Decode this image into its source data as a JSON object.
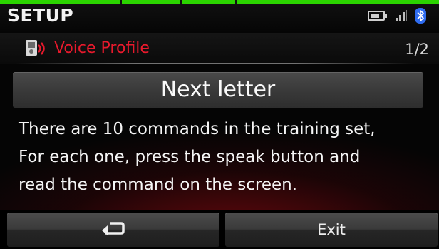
{
  "header": {
    "title": "SETUP",
    "icons": [
      "battery-icon",
      "signal-icon",
      "bluetooth-icon"
    ]
  },
  "subheader": {
    "icon": "voice-profile-icon",
    "label": "Voice Profile",
    "page": "1/2"
  },
  "prompt": {
    "text": "Next letter"
  },
  "message": {
    "lines": [
      "There are 10 commands in the training set,",
      "For each one, press the speak button and",
      "read the command on the screen."
    ]
  },
  "buttons": {
    "back_icon": "return-arrow-icon",
    "exit_label": "Exit"
  },
  "colors": {
    "accent_red": "#e8192c",
    "top_strip_green": "#2bd400",
    "bluetooth_blue": "#2f6cf0",
    "background": "#050505"
  }
}
